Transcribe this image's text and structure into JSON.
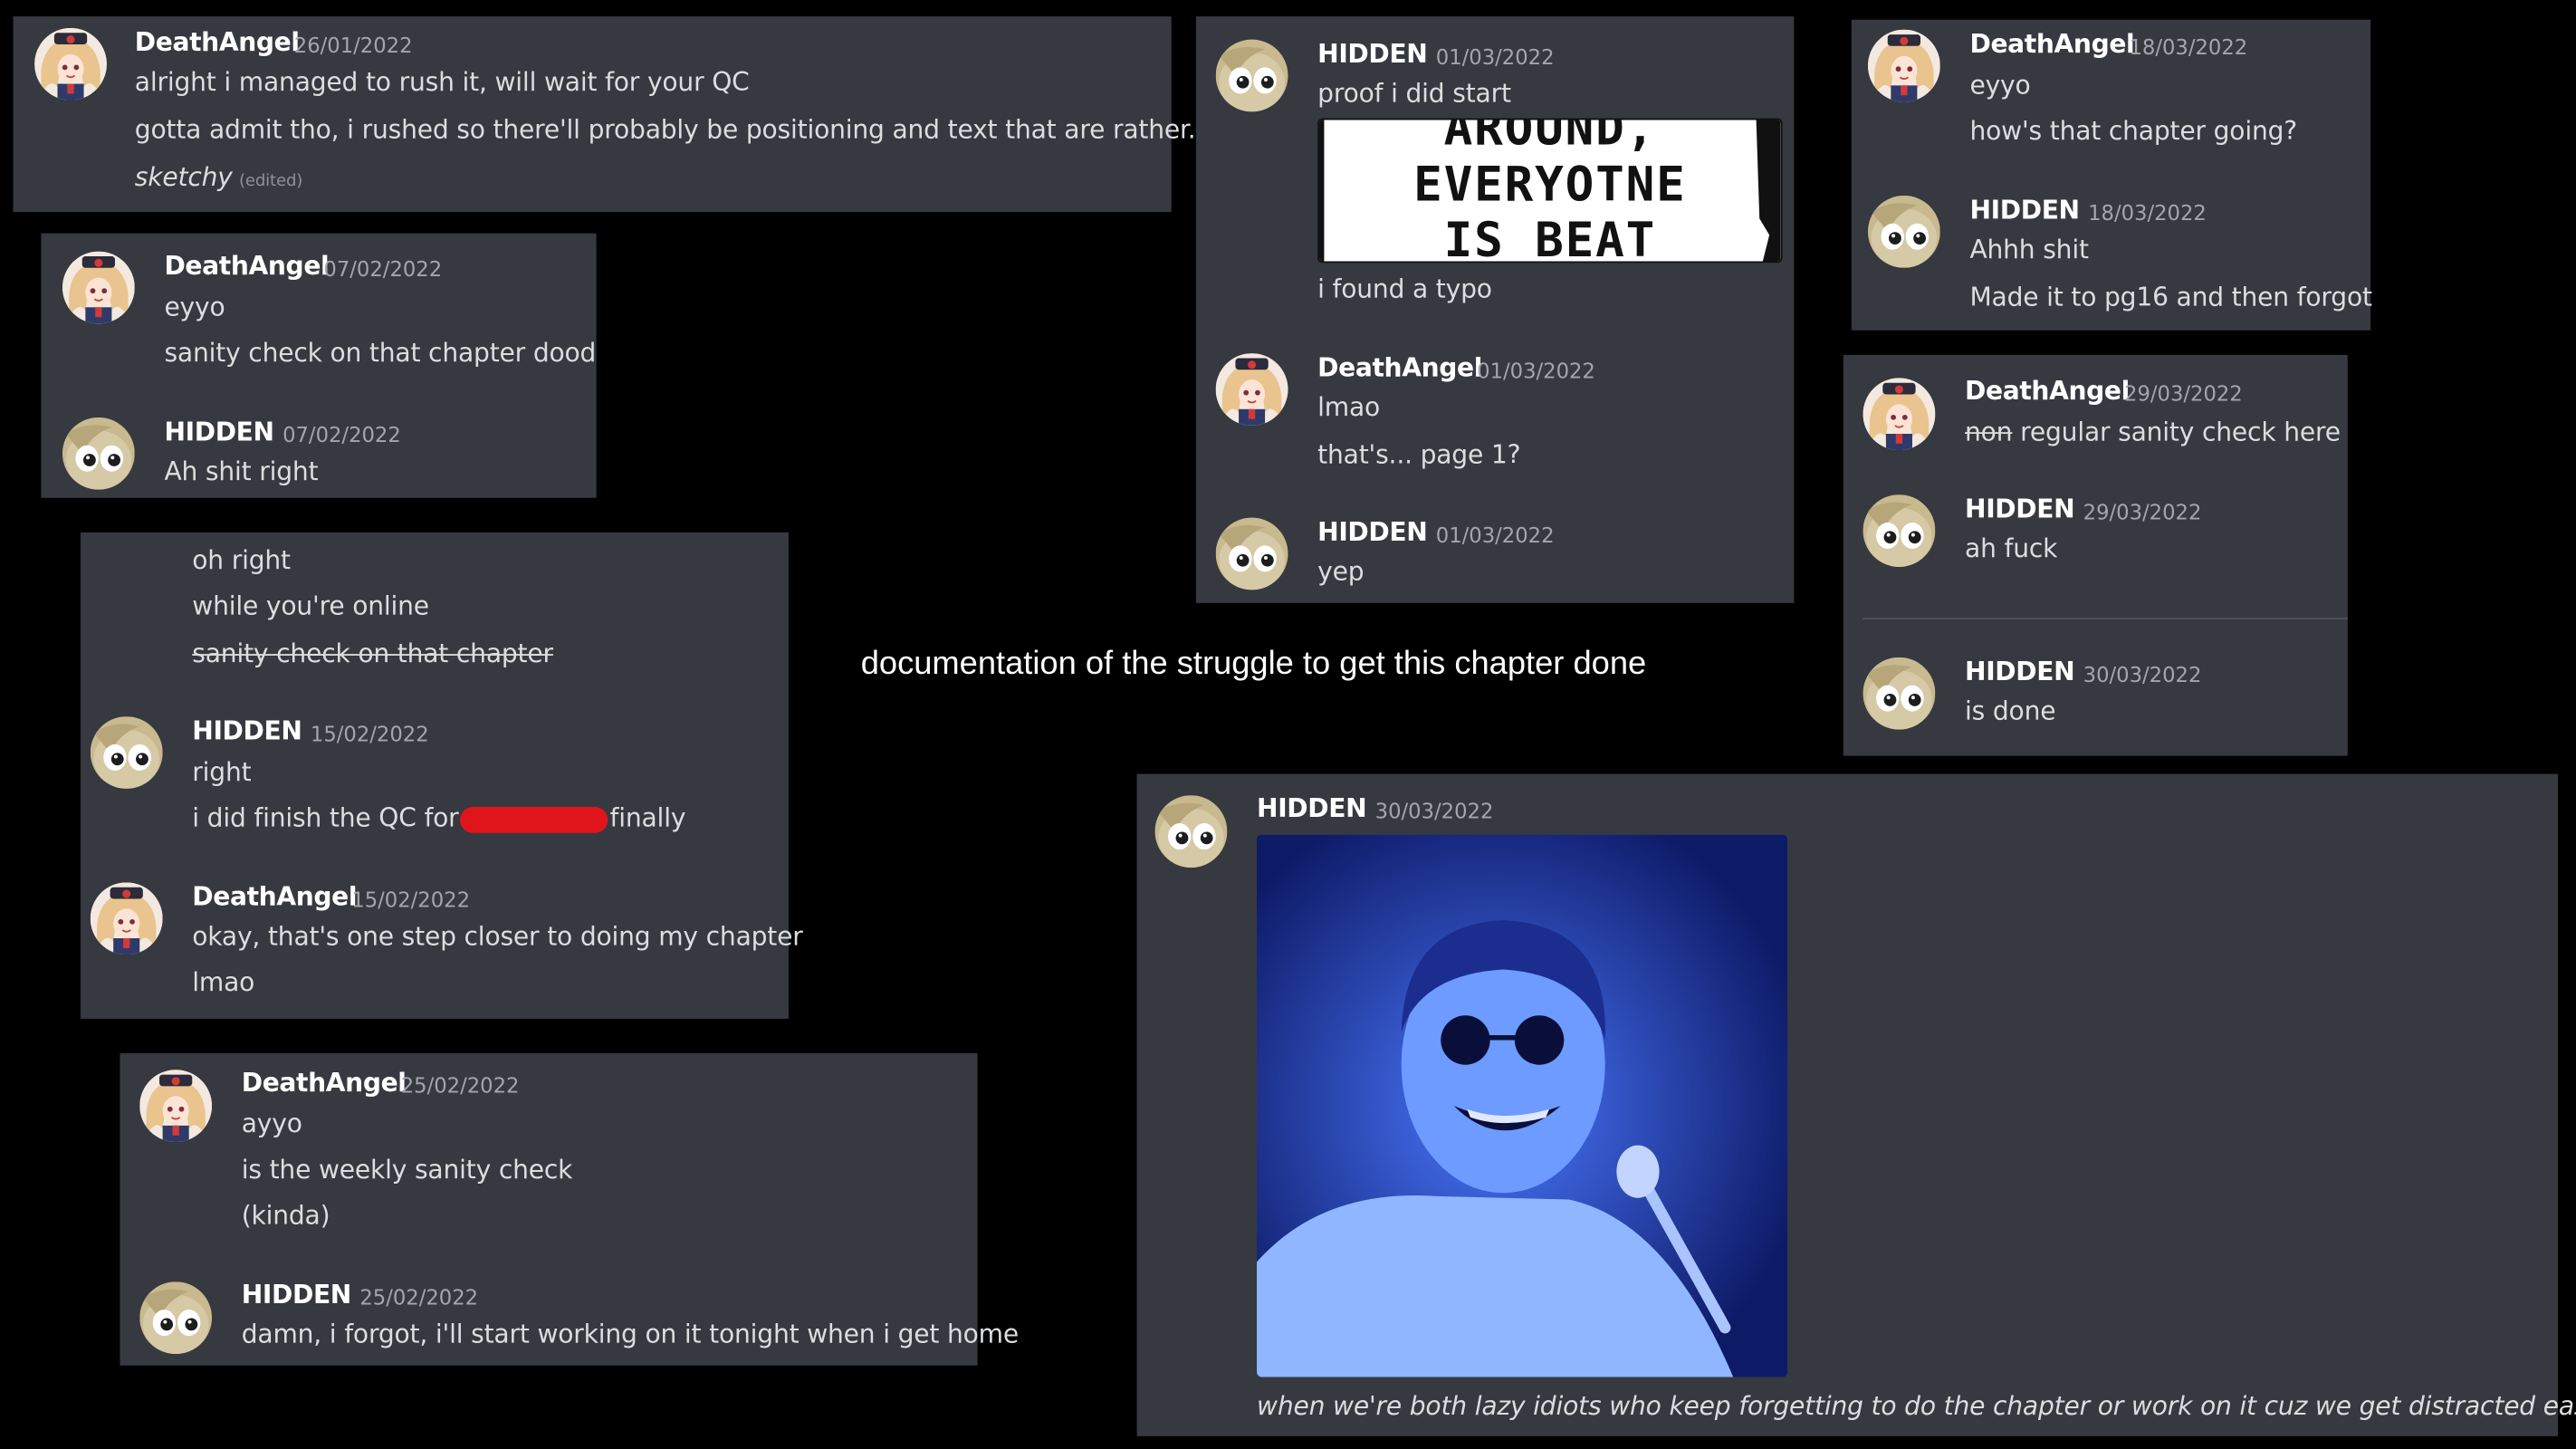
{
  "caption": "documentation of the struggle to get this chapter done",
  "users": {
    "deathangel": "DeathAngel",
    "hidden": "HIDDEN"
  },
  "panels": {
    "p1": {
      "m1": {
        "author": "DeathAngel",
        "date": "26/01/2022",
        "lines": [
          "alright i managed to rush it, will wait for your QC",
          "gotta admit tho, i rushed so there'll probably be positioning and text that are rather...",
          "sketchy"
        ],
        "edited": "(edited)"
      }
    },
    "p2": {
      "m1": {
        "author": "DeathAngel",
        "date": "07/02/2022",
        "lines": [
          "eyyo",
          "sanity check on that chapter dood"
        ]
      },
      "m2": {
        "author": "HIDDEN",
        "date": "07/02/2022",
        "lines": [
          "Ah shit right"
        ]
      }
    },
    "p3": {
      "m0": {
        "lines": [
          "oh right",
          "while you're online",
          "sanity check on that chapter"
        ]
      },
      "m1": {
        "author": "HIDDEN",
        "date": "15/02/2022",
        "lines": [
          "right",
          "i did finish the QC for",
          "finally"
        ]
      },
      "m2": {
        "author": "DeathAngel",
        "date": "15/02/2022",
        "lines": [
          "okay, that's one step closer to doing my chapter",
          "lmao"
        ]
      }
    },
    "p4": {
      "m1": {
        "author": "DeathAngel",
        "date": "25/02/2022",
        "lines": [
          "ayyo",
          "is the weekly sanity check",
          "(kinda)"
        ]
      },
      "m2": {
        "author": "HIDDEN",
        "date": "25/02/2022",
        "lines": [
          "damn, i forgot, i'll start working on it tonight when i get home"
        ]
      }
    },
    "p5": {
      "m1": {
        "author": "HIDDEN",
        "date": "01/03/2022",
        "lines": [
          "proof i did start",
          "i found a typo"
        ],
        "image_text": [
          "AROUND,",
          "EVERYOTNE",
          "IS BEAT"
        ]
      },
      "m2": {
        "author": "DeathAngel",
        "date": "01/03/2022",
        "lines": [
          "lmao",
          "that's... page 1?"
        ]
      },
      "m3": {
        "author": "HIDDEN",
        "date": "01/03/2022",
        "lines": [
          "yep"
        ]
      }
    },
    "p6": {
      "m1": {
        "author": "DeathAngel",
        "date": "18/03/2022",
        "lines": [
          "eyyo",
          "how's that chapter going?"
        ]
      },
      "m2": {
        "author": "HIDDEN",
        "date": "18/03/2022",
        "lines": [
          "Ahhh shit",
          "Made it to pg16 and then forgot"
        ]
      }
    },
    "p7": {
      "m1": {
        "author": "DeathAngel",
        "date": "29/03/2022",
        "lines": [
          "non",
          "regular sanity check here"
        ]
      },
      "m2": {
        "author": "HIDDEN",
        "date": "29/03/2022",
        "lines": [
          "ah fuck"
        ]
      },
      "m3": {
        "author": "HIDDEN",
        "date": "30/03/2022",
        "lines": [
          "is done"
        ]
      }
    },
    "p8": {
      "m1": {
        "author": "HIDDEN",
        "date": "30/03/2022",
        "lines": [
          "when we're both lazy idiots who keep forgetting to do the chapter or work on it cuz we get distracted easily"
        ]
      }
    }
  },
  "colors": {
    "background": "#000000",
    "panel": "#36393f",
    "username": "#ffffff",
    "text": "#dcddde",
    "timestamp": "#a3a6aa",
    "redaction": "#e0141b",
    "image_tint": "#2d4fd6"
  },
  "icons": {
    "deathangel_avatar": "anime-girl-avatar-icon",
    "hidden_avatar": "pony-face-avatar-icon"
  }
}
